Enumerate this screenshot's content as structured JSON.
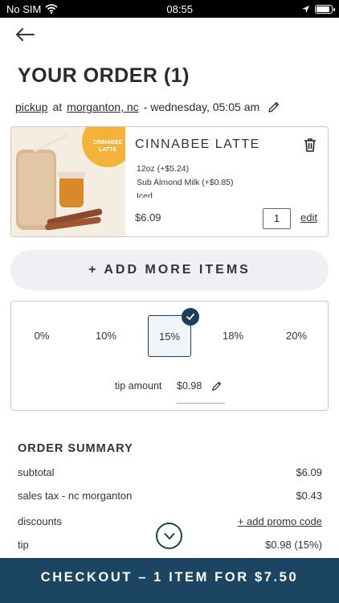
{
  "status_bar": {
    "carrier": "No SIM",
    "time": "08:55",
    "battery_level": 0.9
  },
  "header": {
    "title": "YOUR ORDER (1)"
  },
  "order_meta": {
    "method": "pickup",
    "at": "at",
    "location": "morganton, nc",
    "when": "- wednesday, 05:05 am"
  },
  "cart": {
    "items": [
      {
        "image_label": "CINNABEE LATTE",
        "name": "CINNABEE LATTE",
        "options": [
          "12oz (+$5.24)",
          "Sub Almond Milk (+$0.85)",
          "Iced"
        ],
        "price": "$6.09",
        "quantity": "1",
        "edit_label": "edit"
      }
    ]
  },
  "add_more_label": "+ ADD MORE ITEMS",
  "tip": {
    "options": [
      "0%",
      "10%",
      "15%",
      "18%",
      "20%"
    ],
    "selected": "15%",
    "amount_label": "tip amount",
    "amount_value": "$0.98"
  },
  "summary": {
    "title": "ORDER SUMMARY",
    "rows": [
      {
        "label": "subtotal",
        "value": "$6.09"
      },
      {
        "label": "sales tax - nc morganton",
        "value": "$0.43"
      },
      {
        "label": "discounts",
        "value": "+ add promo code"
      },
      {
        "label": "tip",
        "value": "$0.98 (15%)"
      }
    ]
  },
  "checkout_label": "CHECKOUT – 1 ITEM FOR $7.50",
  "colors": {
    "brand_navy": "#1b4560",
    "accent_yellow": "#f3b23a"
  }
}
